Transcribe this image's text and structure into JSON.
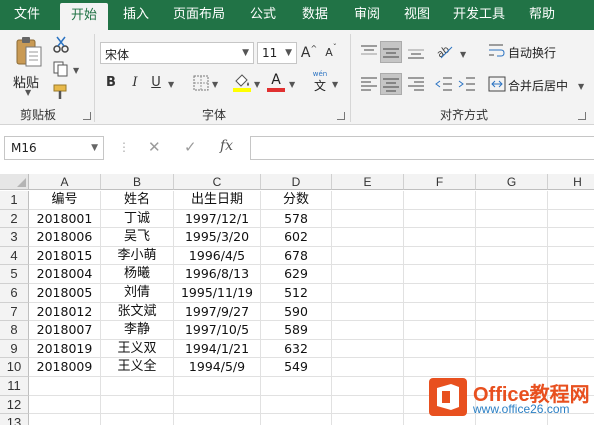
{
  "tabs": [
    {
      "label": "文件",
      "active": false
    },
    {
      "label": "开始",
      "active": true
    },
    {
      "label": "插入",
      "active": false
    },
    {
      "label": "页面布局",
      "active": false
    },
    {
      "label": "公式",
      "active": false
    },
    {
      "label": "数据",
      "active": false
    },
    {
      "label": "审阅",
      "active": false
    },
    {
      "label": "视图",
      "active": false
    },
    {
      "label": "开发工具",
      "active": false
    },
    {
      "label": "帮助",
      "active": false
    }
  ],
  "ribbon": {
    "clipboard": {
      "paste_label": "粘贴",
      "group_label": "剪贴板"
    },
    "font": {
      "font_name": "宋体",
      "font_size": "11",
      "bold": "B",
      "italic": "I",
      "underline": "U",
      "increase": "A",
      "decrease": "A",
      "phonetic_top": "wén",
      "phonetic_bottom": "文",
      "font_color_glyph": "A",
      "group_label": "字体"
    },
    "alignment": {
      "wrap_text": "自动换行",
      "merge_center": "合并后居中",
      "group_label": "对齐方式"
    }
  },
  "formula_bar": {
    "name_box": "M16",
    "dots": "⋮",
    "cancel": "✕",
    "enter": "✓",
    "fx": "fx",
    "formula": ""
  },
  "sheet": {
    "columns": [
      "A",
      "B",
      "C",
      "D",
      "E",
      "F",
      "G",
      "H"
    ],
    "rows": [
      "1",
      "2",
      "3",
      "4",
      "5",
      "6",
      "7",
      "8",
      "9",
      "10",
      "11",
      "12",
      "13"
    ],
    "cells": [
      [
        "编号",
        "姓名",
        "出生日期",
        "分数"
      ],
      [
        "2018001",
        "丁诚",
        "1997/12/1",
        "578"
      ],
      [
        "2018006",
        "吴飞",
        "1995/3/20",
        "602"
      ],
      [
        "2018015",
        "李小萌",
        "1996/4/5",
        "678"
      ],
      [
        "2018004",
        "杨曦",
        "1996/8/13",
        "629"
      ],
      [
        "2018005",
        "刘倩",
        "1995/11/19",
        "512"
      ],
      [
        "2018012",
        "张文斌",
        "1997/9/27",
        "590"
      ],
      [
        "2018007",
        "李静",
        "1997/10/5",
        "589"
      ],
      [
        "2018019",
        "王义双",
        "1994/1/21",
        "632"
      ],
      [
        "2018009",
        "王义全",
        "1994/5/9",
        "549"
      ]
    ]
  },
  "watermark": {
    "title": "Office教程网",
    "url": "www.office26.com"
  },
  "colors": {
    "ribbon_green": "#217346",
    "font_color_bar": "#e03030",
    "fill_color_bar": "#ffff00",
    "watermark_orange": "#e8501f"
  }
}
